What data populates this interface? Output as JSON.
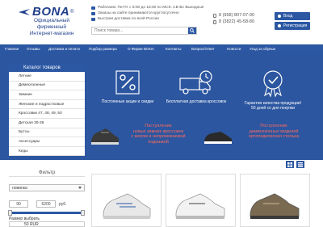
{
  "brand": {
    "name": "BONA",
    "reg": "®",
    "tagline": [
      "Официальный",
      "фирменный",
      "Интернет-магазин"
    ]
  },
  "info_lines": [
    "Работаем: Пн-Пт с 8:00 до 16:00 по МСК. СБ-Вс Выходные",
    "Заказы на сайте принимаются круглосуточно",
    "Быстрая доставка по всей России"
  ],
  "search": {
    "placeholder": "Поиск товара..."
  },
  "phones": [
    "8 (958) 807-07-90",
    "8 (3822) 45-58-80"
  ],
  "account": {
    "login": "Вход",
    "register": "Регистрация"
  },
  "nav": [
    "Главная",
    "Отзывы",
    "Доставка и оплата",
    "Подбор размера",
    "О Фирме BONA",
    "Контакты",
    "Вопрос/Ответ",
    "Новости",
    "Уход за обувью"
  ],
  "sidebar": {
    "title": "Каталог товаров",
    "items": [
      "Летние",
      "Демисезонные",
      "Зимние",
      "Женские и подростковые",
      "Кроссовки 47, 48, 49, 50",
      "Детская 30-36",
      "Бутсы",
      "Аксессуары",
      "Кеды"
    ]
  },
  "features": [
    {
      "icon": "percent-icon",
      "caption": [
        "Постоянные акции и скидки"
      ]
    },
    {
      "icon": "delivery-truck-icon",
      "caption": [
        "Бесплатная доставка кроссовок"
      ]
    },
    {
      "icon": "quality-badge-icon",
      "caption": [
        "Гарантия качества продукции!",
        "50 дней со дня покупки"
      ]
    }
  ],
  "promos": [
    [
      "Поступление",
      "новых зимних кроссовок",
      "с мехом и непромокаемой",
      "подошвой"
    ],
    [
      "Поступление",
      "демисезонных моделей",
      "ортопедическая стелька"
    ]
  ],
  "filter": {
    "title": "Фильтр",
    "sort": "новинка",
    "price_from": "90",
    "price_to": "6200",
    "currency": "руб.",
    "size_label": "Размер выбрать",
    "size_value": "50 RUR"
  },
  "colors": {
    "primary": "#2b57a3",
    "banner": "#2c56a0",
    "promo_text": "#ff6b5c"
  }
}
